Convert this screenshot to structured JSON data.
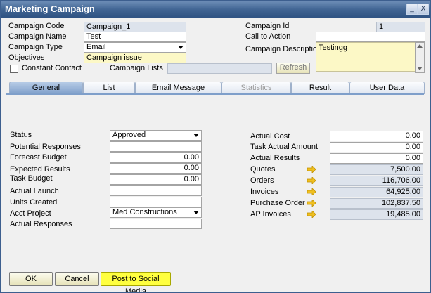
{
  "window": {
    "title": "Marketing Campaign",
    "min_label": "_",
    "close_label": "X"
  },
  "header": {
    "campaign_code_label": "Campaign Code",
    "campaign_code": "Campaign_1",
    "campaign_name_label": "Campaign Name",
    "campaign_name": "Test",
    "campaign_type_label": "Campaign Type",
    "campaign_type": "Email",
    "objectives_label": "Objectives",
    "objectives": "Campaign issue",
    "constant_contact_label": "Constant Contact",
    "campaign_lists_label": "Campaign Lists",
    "campaign_lists": "",
    "refresh_label": "Refresh",
    "campaign_id_label": "Campaign Id",
    "campaign_id": "1",
    "call_to_action_label": "Call to Action",
    "call_to_action": "",
    "campaign_description_label": "Campaign Description",
    "campaign_description": "Testingg"
  },
  "tabs": [
    "General",
    "List",
    "Email Message",
    "Statistics",
    "Result",
    "User Data"
  ],
  "left": {
    "status_label": "Status",
    "status": "Approved",
    "potential_responses_label": "Potential Responses",
    "potential_responses": "",
    "forecast_budget_label": "Forecast Budget",
    "forecast_budget": "0.00",
    "expected_results_label": "Expected Results",
    "expected_results": "0.00",
    "task_budget_label": "Task Budget",
    "task_budget": "0.00",
    "actual_launch_label": "Actual Launch",
    "actual_launch": "",
    "units_created_label": "Units Created",
    "units_created": "",
    "acct_project_label": "Acct Project",
    "acct_project": "Med Constructions",
    "actual_responses_label": "Actual Responses",
    "actual_responses": ""
  },
  "right": {
    "actual_cost_label": "Actual Cost",
    "actual_cost": "0.00",
    "task_actual_amount_label": "Task Actual Amount",
    "task_actual_amount": "0.00",
    "actual_results_label": "Actual Results",
    "actual_results": "0.00",
    "quotes_label": "Quotes",
    "quotes": "7,500.00",
    "orders_label": "Orders",
    "orders": "116,706.00",
    "invoices_label": "Invoices",
    "invoices": "64,925.00",
    "purchase_order_label": "Purchase Order",
    "purchase_order": "102,837.50",
    "ap_invoices_label": "AP Invoices",
    "ap_invoices": "19,485.00"
  },
  "footer": {
    "ok_label": "OK",
    "cancel_label": "Cancel",
    "post_label": "Post to Social Media"
  },
  "colors": {
    "title_bar": "#3f6392",
    "link_arrow": "#f0c020",
    "highlight_button": "#ffff40"
  }
}
